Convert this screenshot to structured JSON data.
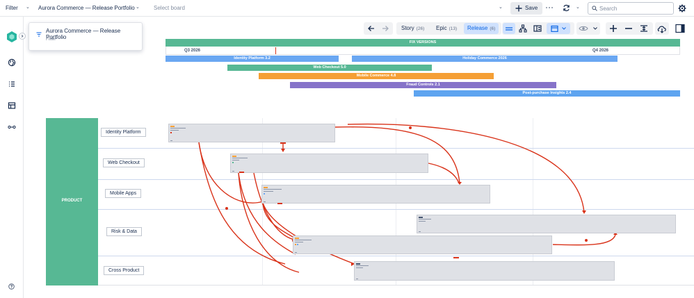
{
  "topbar": {
    "filter_label": "Filter",
    "portfolio_selector": "Aurora Commerce — Release Portfolio",
    "board_placeholder": "Select board",
    "save_label": "Save",
    "search_placeholder": "Search"
  },
  "popup": {
    "title": "Aurora Commerce — Release Portfolio",
    "subtitle": "Filter"
  },
  "view_toolbar": {
    "segments": [
      {
        "label": "Story",
        "count": "(26)"
      },
      {
        "label": "Epic",
        "count": "(13)"
      },
      {
        "label": "Release",
        "count": "(6)"
      }
    ],
    "active_segment": "Release"
  },
  "timeline": {
    "header": "FIX VERSIONS",
    "quarters": [
      "Q3 2026",
      "Q4 2026"
    ],
    "releases": [
      {
        "name": "Identity Platform 3.2",
        "color": "#6aa7f2"
      },
      {
        "name": "Holiday Commerce 2026",
        "color": "#6aa7f2"
      },
      {
        "name": "Web Checkout 5.0",
        "color": "#57b894"
      },
      {
        "name": "Mobile Commerce 4.8",
        "color": "#f59f35"
      },
      {
        "name": "Fraud Controls 2.1",
        "color": "#8673c9"
      },
      {
        "name": "Post-purchase Insights 2.4",
        "color": "#5ea4f0"
      }
    ]
  },
  "board": {
    "product_label": "PRODUCT",
    "teams": [
      "Identity Platform",
      "Web Checkout",
      "Mobile Apps",
      "Risk & Data",
      "Cross Product"
    ]
  },
  "colors": {
    "accent": "#0c66e4",
    "product_lane": "#57b894",
    "fix_versions_header": "#57b894",
    "dependency_line": "#d9331a",
    "card_fill": "#dfe1e6"
  }
}
